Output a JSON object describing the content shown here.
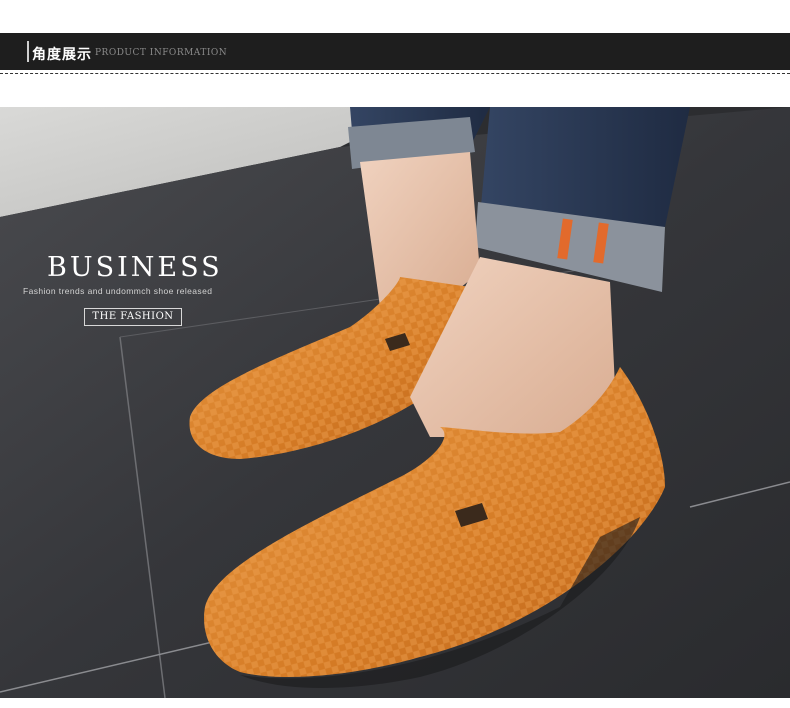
{
  "header": {
    "title_cn": "角度展示",
    "title_en": "PRODUCT INFORMATION"
  },
  "banner": {
    "title": "BUSINESS",
    "tagline": "Fashion trends and undommch shoe released",
    "badge": "THE FASHION"
  },
  "colors": {
    "header_bg": "#1e1e1e",
    "shoe": "#d9822b",
    "denim": "#2b3a55",
    "floor": "#3a3b3f"
  }
}
